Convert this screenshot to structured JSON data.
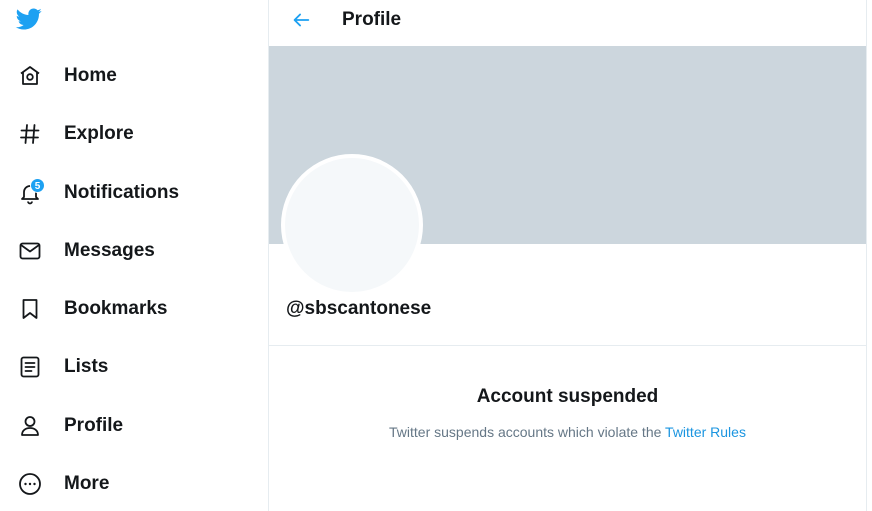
{
  "colors": {
    "accent": "#1da1f2",
    "banner": "#ccd6dd",
    "text": "#14171a",
    "muted": "#657786",
    "link": "#1b95e0"
  },
  "sidebar": {
    "logo_icon": "twitter-bird-icon",
    "items": [
      {
        "label": "Home",
        "icon": "home-icon"
      },
      {
        "label": "Explore",
        "icon": "hashtag-icon"
      },
      {
        "label": "Notifications",
        "icon": "bell-icon",
        "badge": "5"
      },
      {
        "label": "Messages",
        "icon": "envelope-icon"
      },
      {
        "label": "Bookmarks",
        "icon": "bookmark-icon"
      },
      {
        "label": "Lists",
        "icon": "list-icon"
      },
      {
        "label": "Profile",
        "icon": "person-icon"
      },
      {
        "label": "More",
        "icon": "more-icon"
      }
    ]
  },
  "header": {
    "title": "Profile",
    "back_icon": "arrow-left-icon"
  },
  "profile": {
    "handle": "@sbscantonese"
  },
  "suspension": {
    "title": "Account suspended",
    "message": "Twitter suspends accounts which violate the",
    "link": "Twitter Rules"
  }
}
